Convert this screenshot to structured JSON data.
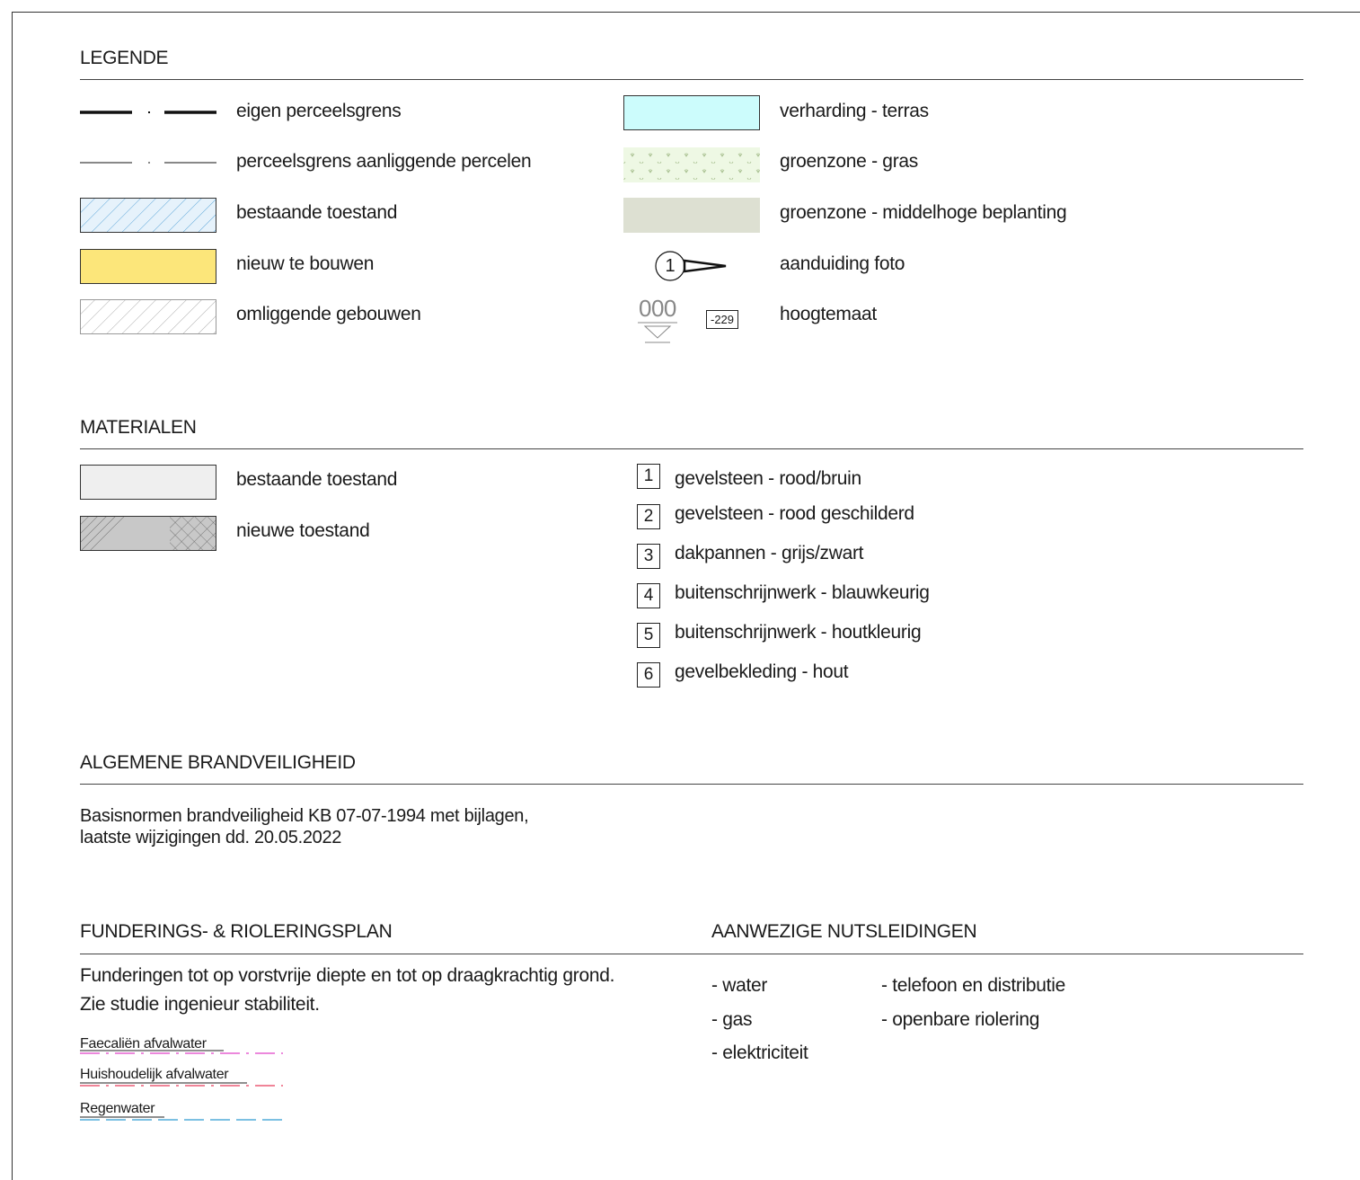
{
  "colors": {
    "verharding": "#ccfcfc",
    "gras": "#eef8e4",
    "beplanting": "#dde0d2",
    "nieuw": "#fce67a",
    "bestaand_hatch": "#5aa5d8",
    "bestaand_fill": "#e6f2fb",
    "materiaal_bestaand": "#efefef",
    "materiaal_nieuw": "#c8c8c8",
    "faecalien": "#e040c8",
    "huishoudelijk": "#e83a5a",
    "regenwater": "#2e9ad0"
  },
  "legende": {
    "title": "LEGENDE",
    "left": [
      {
        "label": "eigen perceelsgrens",
        "icon": "thick-dash-dot-line"
      },
      {
        "label": "perceelsgrens aanliggende percelen",
        "icon": "thin-dash-dot-line"
      },
      {
        "label": "bestaande toestand",
        "icon": "blue-hatch-swatch"
      },
      {
        "label": "nieuw te bouwen",
        "icon": "yellow-swatch"
      },
      {
        "label": "omliggende gebouwen",
        "icon": "grey-hatch-swatch"
      }
    ],
    "right": [
      {
        "label": "verharding - terras",
        "icon": "cyan-swatch"
      },
      {
        "label": "groenzone - gras",
        "icon": "grass-swatch"
      },
      {
        "label": "groenzone - middelhoge beplanting",
        "icon": "planting-swatch"
      },
      {
        "label": "aanduiding foto",
        "icon": "photo-marker-icon",
        "marker_number": "1"
      },
      {
        "label": "hoogtemaat",
        "icon": "height-marker-icon",
        "marker_value": "000",
        "tag_value": "-229"
      }
    ]
  },
  "materialen": {
    "title": "MATERIALEN",
    "left": [
      {
        "label": "bestaande toestand"
      },
      {
        "label": "nieuwe toestand"
      }
    ],
    "right": [
      {
        "num": "1",
        "label": "gevelsteen - rood/bruin"
      },
      {
        "num": "2",
        "label": "gevelsteen - rood geschilderd"
      },
      {
        "num": "3",
        "label": "dakpannen - grijs/zwart"
      },
      {
        "num": "4",
        "label": "buitenschrijnwerk - blauwkeurig"
      },
      {
        "num": "5",
        "label": "buitenschrijnwerk - houtkleurig"
      },
      {
        "num": "6",
        "label": "gevelbekleding - hout"
      }
    ]
  },
  "brand": {
    "title": "ALGEMENE BRANDVEILIGHEID",
    "line1": "Basisnormen brandveiligheid KB 07-07-1994 met bijlagen,",
    "line2": "laatste wijzigingen dd. 20.05.2022"
  },
  "fundering": {
    "title": "FUNDERINGS- & RIOLERINGSPLAN",
    "line1": "Funderingen tot op vorstvrije diepte en tot op draagkrachtig grond.",
    "line2": "Zie studie ingenieur stabiliteit.",
    "pipes": [
      {
        "label": "Faecaliën afvalwater"
      },
      {
        "label": "Huishoudelijk afvalwater"
      },
      {
        "label": "Regenwater"
      }
    ]
  },
  "nuts": {
    "title": "AANWEZIGE NUTSLEIDINGEN",
    "col1": [
      "- water",
      "- gas",
      "- elektriciteit"
    ],
    "col2": [
      "- telefoon en distributie",
      "- openbare riolering"
    ]
  }
}
